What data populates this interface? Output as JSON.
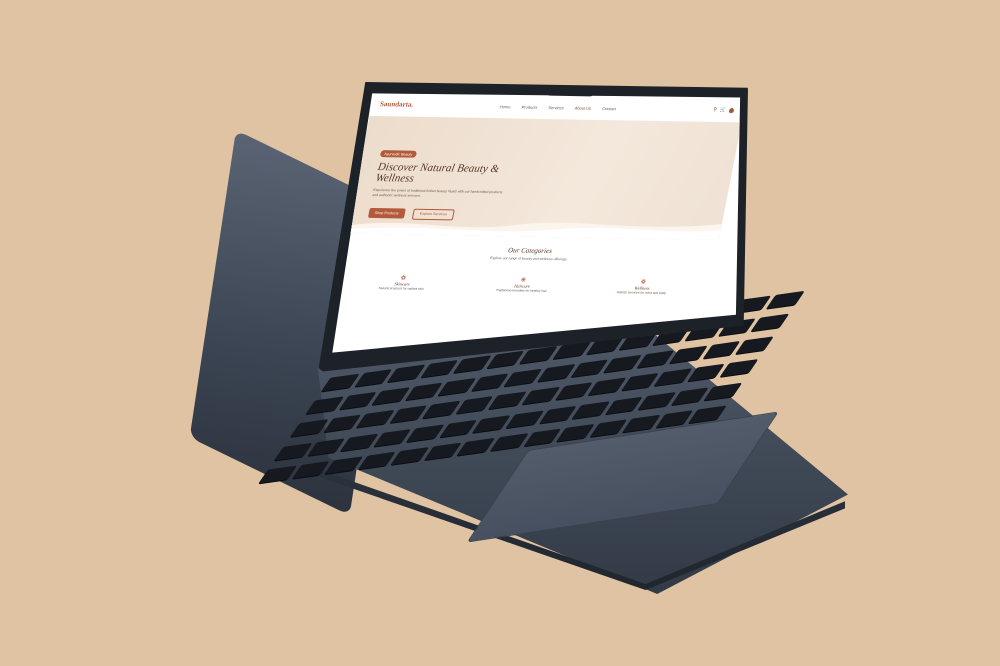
{
  "nav": {
    "logo": "Saundarta.",
    "menu": [
      "Home",
      "Products",
      "Services",
      "About Us",
      "Contact"
    ],
    "search_icon": "search-icon",
    "cart_icon": "cart-icon",
    "cart_count": "0"
  },
  "hero": {
    "badge": "Ayurvedic Beauty",
    "title": "Discover Natural Beauty & Wellness",
    "subtitle": "Experience the power of traditional Indian beauty rituals with our handcrafted products and authentic wellness services.",
    "primary_cta": "Shop Products",
    "secondary_cta": "Explore Services"
  },
  "categories": {
    "title": "Our Categories",
    "subtitle": "Explore our range of beauty and wellness offerings",
    "items": [
      {
        "name": "Skincare",
        "desc": "Natural products for radiant skin",
        "icon": "leaf-icon"
      },
      {
        "name": "Haircare",
        "desc": "Traditional remedies for healthy hair",
        "icon": "lotus-icon"
      },
      {
        "name": "Wellness",
        "desc": "Holistic services for mind and body",
        "icon": "hands-icon"
      }
    ]
  },
  "colors": {
    "accent": "#b25a3a",
    "hero_bg": "#f1e4d6",
    "background": "#dfc3a2",
    "laptop": "#3e4754"
  }
}
